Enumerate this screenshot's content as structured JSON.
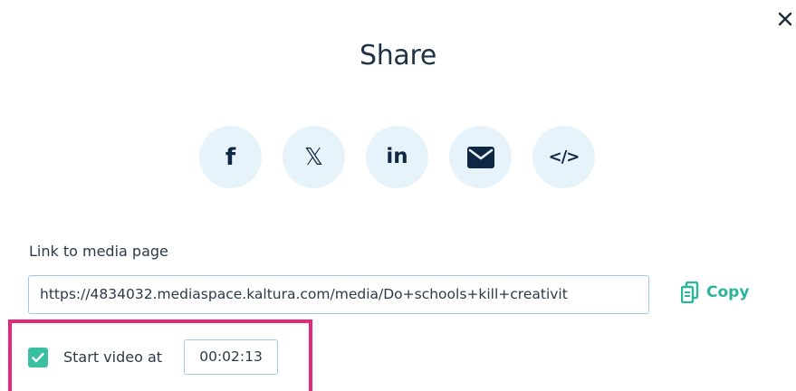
{
  "dialog": {
    "title": "Share",
    "close_icon": "close-icon"
  },
  "social": [
    {
      "name": "facebook",
      "glyph": "f",
      "icon": "facebook-icon"
    },
    {
      "name": "x",
      "glyph": "𝕏",
      "icon": "x-icon"
    },
    {
      "name": "linkedin",
      "glyph": "in",
      "icon": "linkedin-icon"
    },
    {
      "name": "email",
      "glyph": "",
      "icon": "envelope-icon"
    },
    {
      "name": "embed",
      "glyph": "</>",
      "icon": "code-icon"
    }
  ],
  "link": {
    "label": "Link to media page",
    "value": "https://4834032.mediaspace.kaltura.com/media/Do+schools+kill+creativit",
    "copy_label": "Copy"
  },
  "start": {
    "checked": true,
    "label": "Start video at",
    "time": "00:02:13"
  },
  "colors": {
    "accent": "#2bb59a",
    "highlight": "#e4287b",
    "social_bg": "#e6f3fb",
    "title": "#1f3347"
  }
}
